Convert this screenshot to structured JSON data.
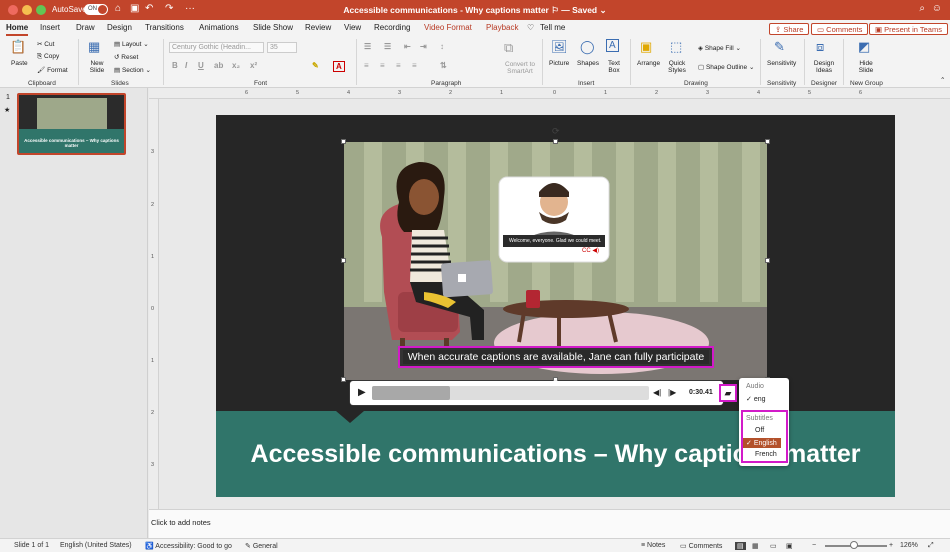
{
  "titlebar": {
    "autosave_label": "AutoSave",
    "autosave_state": "ON",
    "title": "Accessible communications - Why captions matter ⚐ — Saved ⌄",
    "colors": {
      "bar": "#c2452b"
    }
  },
  "tabs": [
    "Home",
    "Insert",
    "Draw",
    "Design",
    "Transitions",
    "Animations",
    "Slide Show",
    "Review",
    "View",
    "Recording",
    "Video Format",
    "Playback",
    "Tell me"
  ],
  "header_buttons": {
    "share": "Share",
    "comments": "Comments",
    "teams": "Present in Teams"
  },
  "ribbon": {
    "clipboard": {
      "paste": "Paste",
      "cut": "Cut",
      "copy": "Copy",
      "format": "Format",
      "group": "Clipboard"
    },
    "slides": {
      "new_slide": "New Slide",
      "layout": "Layout",
      "reset": "Reset",
      "section": "Section",
      "group": "Slides"
    },
    "font": {
      "name": "Century Gothic (Headin...",
      "size": "35",
      "group": "Font"
    },
    "paragraph": {
      "convert": "Convert to SmartArt",
      "group": "Paragraph"
    },
    "insert": {
      "picture": "Picture",
      "shapes": "Shapes",
      "textbox": "Text Box",
      "group": "Insert"
    },
    "drawing": {
      "arrange": "Arrange",
      "quick_styles": "Quick Styles",
      "shape_fill": "Shape Fill",
      "shape_outline": "Shape Outline",
      "group": "Drawing"
    },
    "sensitivity": {
      "label": "Sensitivity",
      "group": "Sensitivity"
    },
    "designer": {
      "label": "Design Ideas",
      "group": "Designer"
    },
    "newgroup": {
      "label": "Hide Slide",
      "group": "New Group"
    }
  },
  "thumbs": {
    "slide_number": "1",
    "star": "★",
    "thumb_title": "Accessible communications – Why captions matter"
  },
  "ruler": {
    "top": [
      "6",
      "5",
      "4",
      "3",
      "2",
      "1",
      "0",
      "1",
      "2",
      "3",
      "4",
      "5",
      "6"
    ],
    "left": [
      "3",
      "2",
      "1",
      "0",
      "1",
      "2",
      "3"
    ]
  },
  "video": {
    "inner_caption": "Welcome, everyone. Glad we could meet.",
    "caption": "When accurate captions are available, Jane can fully participate",
    "time": "0:30.41",
    "progress": 0.28
  },
  "subtitle_menu": {
    "audio_header": "Audio",
    "audio_item": "eng",
    "subtitles_header": "Subtitles",
    "items": [
      "Off",
      "English",
      "French"
    ],
    "selected": "English"
  },
  "slide": {
    "title": "Accessible communications – Why captions matter"
  },
  "notes": {
    "placeholder": "Click to add notes"
  },
  "status": {
    "slide": "Slide 1 of 1",
    "language": "English (United States)",
    "accessibility": "Accessibility: Good to go",
    "general": "General",
    "notes": "Notes",
    "comments": "Comments",
    "zoom": "126%"
  }
}
